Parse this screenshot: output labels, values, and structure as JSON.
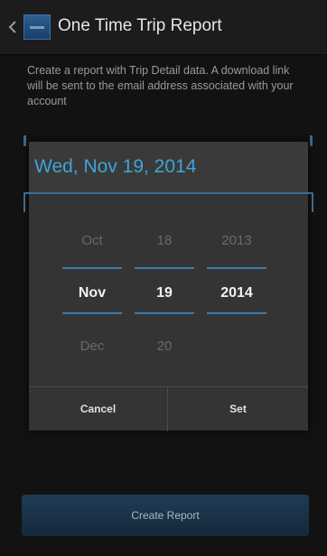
{
  "action_bar": {
    "title": "One Time Trip Report"
  },
  "intro_text": "Create a report with Trip Detail data. A download link will be sent to the email address associated with your account",
  "date_dialog": {
    "header_date": "Wed, Nov 19, 2014",
    "month": {
      "prev": "Oct",
      "selected": "Nov",
      "next": "Dec"
    },
    "day": {
      "prev": "18",
      "selected": "19",
      "next": "20"
    },
    "year": {
      "prev": "2013",
      "selected": "2014"
    },
    "cancel_label": "Cancel",
    "set_label": "Set"
  },
  "create_report_label": "Create Report",
  "colors": {
    "accent_blue": "#3ea4d7",
    "selection_line": "#3b7fa8",
    "background": "#121212"
  }
}
